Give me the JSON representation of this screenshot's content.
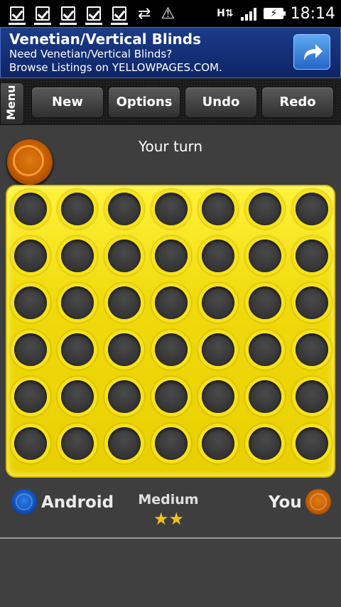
{
  "status_bar": {
    "notifications": [
      "task-check-icon",
      "task-check-icon",
      "task-check-icon",
      "task-check-icon",
      "task-check-icon"
    ],
    "icons": [
      "sync-icon",
      "warning-icon",
      "hspa-icon",
      "signal-icon",
      "battery-charging-icon"
    ],
    "time": "18:14"
  },
  "ad": {
    "title": "Venetian/Vertical Blinds",
    "line1": "Need Venetian/Vertical Blinds?",
    "line2": "Browse Listings on YELLOWPAGES.COM."
  },
  "toolbar": {
    "menu_label": "Menu",
    "buttons": [
      "New",
      "Options",
      "Undo",
      "Redo"
    ]
  },
  "game": {
    "turn_text": "Your turn",
    "rows": 6,
    "cols": 7,
    "opponent_name": "Android",
    "player_name": "You",
    "difficulty": "Medium",
    "difficulty_stars": 2
  },
  "colors": {
    "board": "#f0da0c",
    "player": "#c45c00",
    "opponent": "#0d4fb8"
  }
}
